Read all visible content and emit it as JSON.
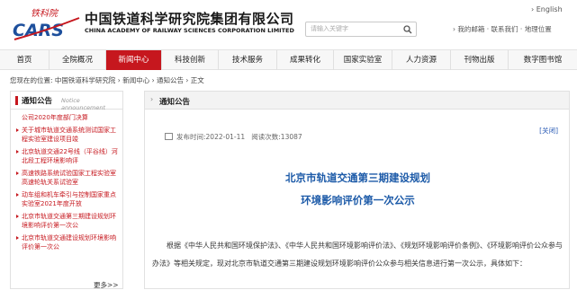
{
  "header": {
    "logo_script": "铁科院",
    "logo_letters": "CARS",
    "org_name_cn": "中国铁道科学研究院集团有限公司",
    "org_name_en": "CHINA ACADEMY OF RAILWAY SCIENCES CORPORATION LIMITED",
    "search_placeholder": "请输入关键字",
    "english_link": "English",
    "top_links": [
      "我的邮箱",
      "联系我们",
      "地理位置"
    ]
  },
  "nav": {
    "items": [
      "首页",
      "全院概况",
      "新闻中心",
      "科技创新",
      "技术服务",
      "成果转化",
      "国家实验室",
      "人力资源",
      "刊物出版",
      "数字图书馆"
    ],
    "active": "新闻中心"
  },
  "breadcrumb": {
    "prefix": "您现在的位置:",
    "parts": [
      "中国铁道科学研究院",
      "新闻中心",
      "通知公告",
      "正文"
    ]
  },
  "sidebar": {
    "title": "通知公告",
    "subtitle": "Notice announcement",
    "items": [
      {
        "text": "公司2020年度部门决算",
        "dot": false
      },
      {
        "text": "关于城市轨道交通系统测试国家工程实验室建设项目竣",
        "dot": true
      },
      {
        "text": "北京轨道交通22号线（平谷线）河北段工程环境影响评",
        "dot": true
      },
      {
        "text": "高速铁路系统试验国家工程实验室高速轮轨关系试验室",
        "dot": true
      },
      {
        "text": "动车组和机车牵引与控制国家重点实验室2021年度开放",
        "dot": true
      },
      {
        "text": "北京市轨道交通第三期建设规划环境影响评价第一次公",
        "dot": true
      },
      {
        "text": "北京市轨道交通建设规划环境影响评价第一次公",
        "dot": true
      }
    ],
    "more": "更多>>"
  },
  "article": {
    "section": "通知公告",
    "publish_label": "发布时间:2022-01-11",
    "views_label": "阅读次数:13087",
    "close_label": "[关闭]",
    "title_line1": "北京市轨道交通第三期建设规划",
    "title_line2": "环境影响评价第一次公示",
    "body": "根据《中华人民共和国环境保护法》、《中华人民共和国环境影响评价法》、《规划环境影响评价条例》、《环境影响评价公众参与办法》等相关规定，现对北京市轨道交通第三期建设规划环境影响评价公众参与相关信息进行第一次公示，具体如下："
  },
  "colors": {
    "brand_red": "#c6171e",
    "title_blue": "#1c5aa8",
    "logo_blue": "#1d4f9c"
  }
}
